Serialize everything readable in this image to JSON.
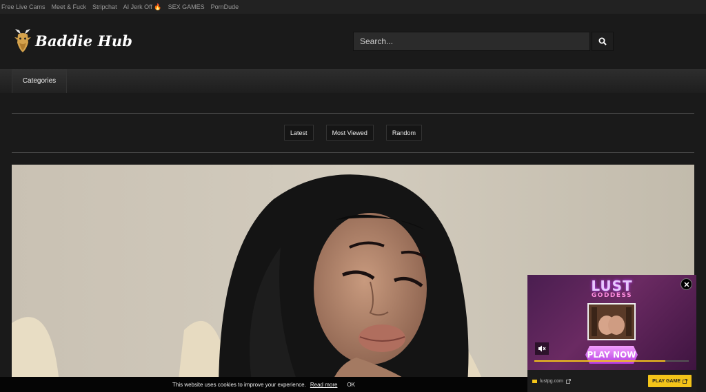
{
  "top_links": [
    "Free Live Cams",
    "Meet & Fuck",
    "Stripchat",
    "AI Jerk Off 🔥",
    "SEX GAMES",
    "PornDude"
  ],
  "site": {
    "name": "Baddie Hub"
  },
  "search": {
    "placeholder": "Search..."
  },
  "nav": {
    "categories": "Categories"
  },
  "filters": [
    "Latest",
    "Most Viewed",
    "Random"
  ],
  "ad": {
    "brand_line1": "LUST",
    "brand_line2": "GODDESS",
    "cta": "PLAY NOW",
    "domain": "lustpg.com",
    "button": "PLAY GAME",
    "progress": 0.85,
    "accent_color": "#f3c419"
  },
  "cookie": {
    "message": "This website uses cookies to improve your experience.",
    "link": "Read more",
    "ok": "OK"
  },
  "icons": [
    "goat-logo-icon",
    "search-icon",
    "close-icon",
    "mute-icon",
    "mail-icon",
    "external-link-icon"
  ]
}
